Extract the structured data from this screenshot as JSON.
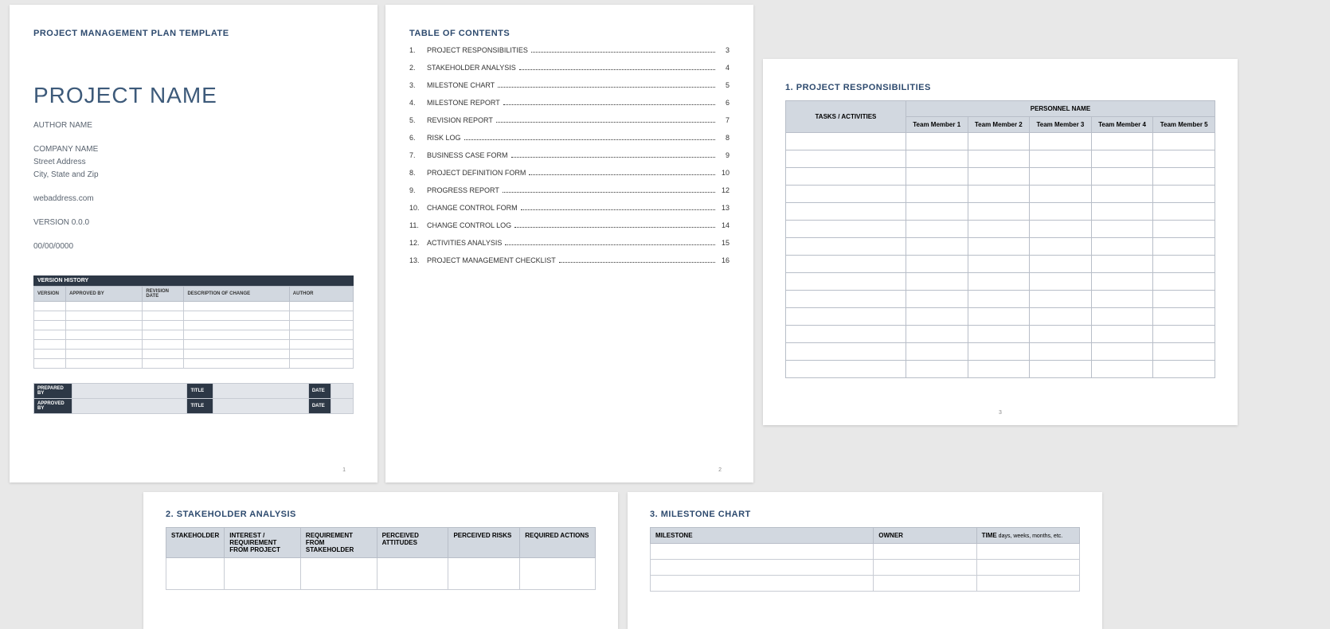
{
  "page1": {
    "doc_type": "PROJECT MANAGEMENT PLAN TEMPLATE",
    "project_name": "PROJECT NAME",
    "author": "AUTHOR NAME",
    "company": "COMPANY NAME",
    "street": "Street Address",
    "city": "City, State and Zip",
    "web": "webaddress.com",
    "version": "VERSION 0.0.0",
    "date": "00/00/0000",
    "vh_title": "VERSION HISTORY",
    "vh_headers": {
      "a": "VERSION",
      "b": "APPROVED BY",
      "c": "REVISION DATE",
      "d": "DESCRIPTION OF CHANGE",
      "e": "AUTHOR"
    },
    "sign": {
      "prep": "PREPARED BY",
      "appr": "APPROVED BY",
      "title": "TITLE",
      "date": "DATE"
    },
    "pgnum": "1"
  },
  "page2": {
    "title": "TABLE OF CONTENTS",
    "items": [
      {
        "n": "1.",
        "label": "PROJECT RESPONSIBILITIES",
        "pg": "3"
      },
      {
        "n": "2.",
        "label": "STAKEHOLDER ANALYSIS",
        "pg": "4"
      },
      {
        "n": "3.",
        "label": "MILESTONE CHART",
        "pg": "5"
      },
      {
        "n": "4.",
        "label": "MILESTONE REPORT",
        "pg": "6"
      },
      {
        "n": "5.",
        "label": "REVISION REPORT",
        "pg": "7"
      },
      {
        "n": "6.",
        "label": "RISK LOG",
        "pg": "8"
      },
      {
        "n": "7.",
        "label": "BUSINESS CASE FORM",
        "pg": "9"
      },
      {
        "n": "8.",
        "label": "PROJECT DEFINITION FORM",
        "pg": "10"
      },
      {
        "n": "9.",
        "label": "PROGRESS REPORT",
        "pg": "12"
      },
      {
        "n": "10.",
        "label": "CHANGE CONTROL FORM",
        "pg": "13"
      },
      {
        "n": "11.",
        "label": "CHANGE CONTROL LOG",
        "pg": "14"
      },
      {
        "n": "12.",
        "label": "ACTIVITIES ANALYSIS",
        "pg": "15"
      },
      {
        "n": "13.",
        "label": "PROJECT MANAGEMENT CHECKLIST",
        "pg": "16"
      }
    ],
    "pgnum": "2"
  },
  "page3": {
    "title": "1.  PROJECT RESPONSIBILITIES",
    "head_tasks": "TASKS / ACTIVITIES",
    "head_personnel": "PERSONNEL NAME",
    "members": {
      "a": "Team Member 1",
      "b": "Team Member 2",
      "c": "Team Member 3",
      "d": "Team Member 4",
      "e": "Team Member 5"
    },
    "pgnum": "3"
  },
  "page4": {
    "title": "2.  STAKEHOLDER ANALYSIS",
    "headers": {
      "a": "STAKEHOLDER",
      "b": "INTEREST / REQUIREMENT FROM PROJECT",
      "c": "REQUIREMENT FROM STAKEHOLDER",
      "d": "PERCEIVED ATTITUDES",
      "e": "PERCEIVED RISKS",
      "f": "REQUIRED ACTIONS"
    }
  },
  "page5": {
    "title": "3.  MILESTONE CHART",
    "headers": {
      "a": "MILESTONE",
      "b": "OWNER",
      "c": "TIME",
      "c_sub": " days, weeks, months, etc."
    }
  }
}
